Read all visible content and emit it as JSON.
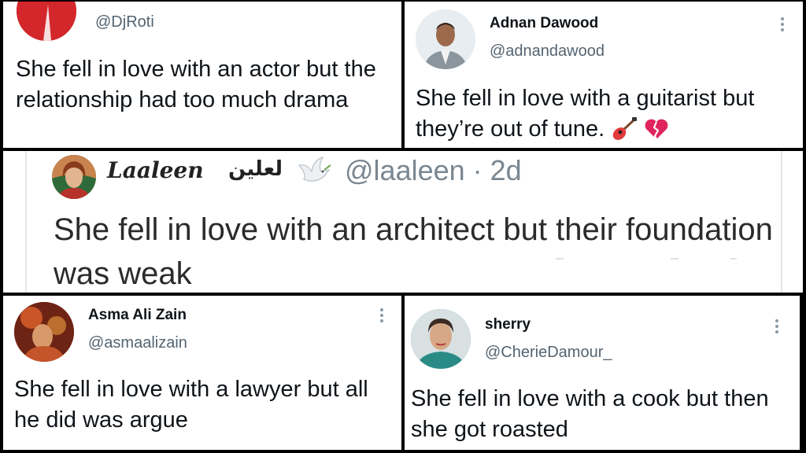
{
  "tweets": [
    {
      "handle": "@DjRoti",
      "text": "She fell in love with an actor but the relationship had too much drama"
    },
    {
      "name": "Adnan Dawood",
      "handle": "@adnandawood",
      "text": "She fell in love with a guitarist but they’re out of tune.",
      "emoji": [
        "guitar-emoji",
        "broken-heart-emoji"
      ]
    },
    {
      "name": "Laaleen",
      "name_urdu": "لعلین",
      "handle": "@laaleen",
      "time": "· 2d",
      "text": "She fell in love with an architect but their foundation was weak"
    },
    {
      "name": "Asma Ali Zain",
      "handle": "@asmaalizain",
      "text": "She fell in love with a lawyer but all he did was argue"
    },
    {
      "name": "sherry",
      "handle": "@CherieDamour_",
      "text": "She fell in love with a cook but then she got roasted"
    }
  ],
  "colors": {
    "text": "#0f1419",
    "secondary": "#536471",
    "background": "#ffffff",
    "separator": "#000000"
  }
}
